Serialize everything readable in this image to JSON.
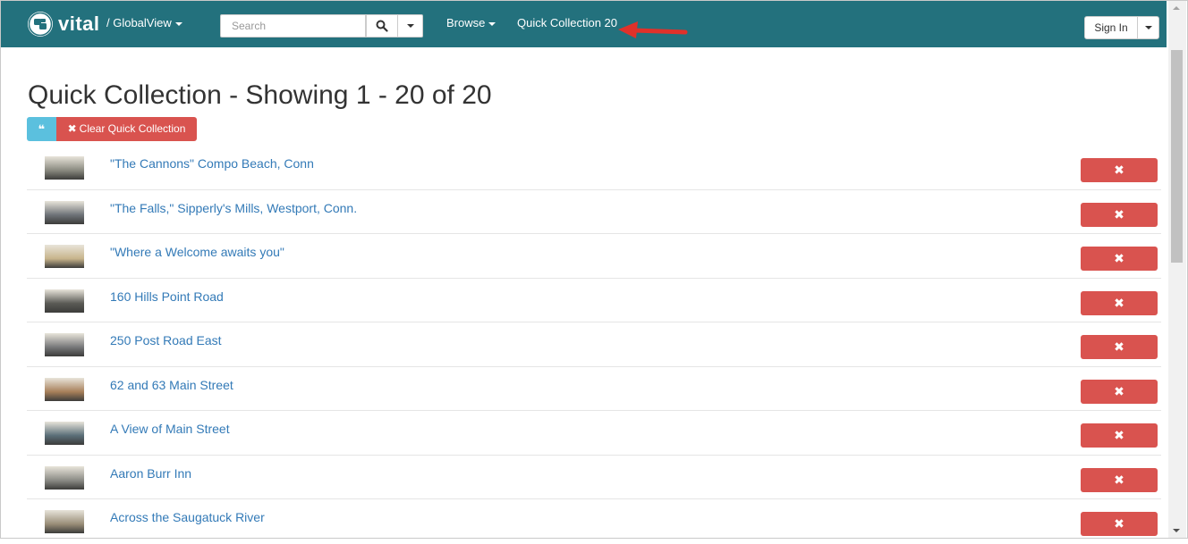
{
  "navbar": {
    "brand": "vital",
    "collection_menu": "/ GlobalView",
    "search_placeholder": "Search",
    "browse_label": "Browse",
    "quick_collection_label": "Quick Collection 20",
    "sign_in_label": "Sign In",
    "bg_color": "#23717d"
  },
  "page": {
    "title": "Quick Collection - Showing 1 - 20 of 20",
    "cite_icon": "quote-icon",
    "clear_label": "Clear Quick Collection"
  },
  "items": [
    {
      "title": "\"The Cannons\" Compo Beach, Conn",
      "thumb": "#8a8a80"
    },
    {
      "title": "\"The Falls,\" Sipperly's Mills, Westport, Conn.",
      "thumb": "#6e7378"
    },
    {
      "title": "\"Where a Welcome awaits you\"",
      "thumb": "#c8b48c"
    },
    {
      "title": "160 Hills Point Road",
      "thumb": "#5a5a55"
    },
    {
      "title": "250 Post Road East",
      "thumb": "#77787a"
    },
    {
      "title": "62 and 63 Main Street",
      "thumb": "#a8805a"
    },
    {
      "title": "A View of Main Street",
      "thumb": "#5a6e78"
    },
    {
      "title": "Aaron Burr Inn",
      "thumb": "#8c8c86"
    },
    {
      "title": "Across the Saugatuck River",
      "thumb": "#9a8e78"
    }
  ],
  "remove_icon": "close-icon",
  "danger_color": "#d9534f",
  "link_color": "#337ab7"
}
